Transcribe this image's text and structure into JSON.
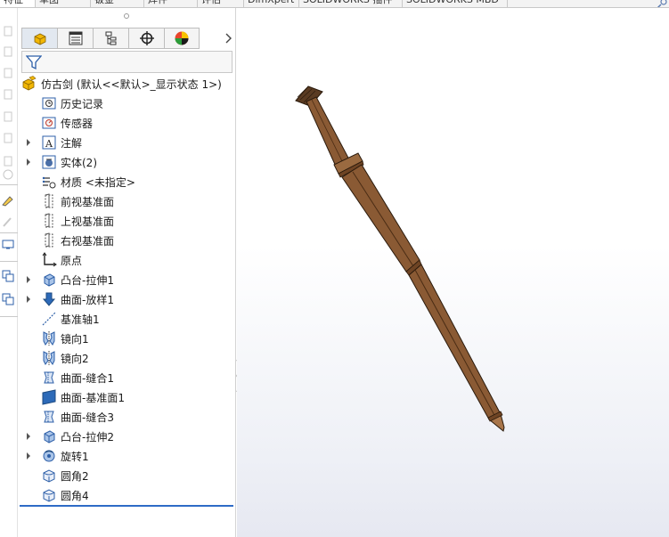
{
  "command_tabs": [
    "特征",
    "草图",
    "钣金",
    "焊件",
    "评估",
    "DimXpert",
    "SOLIDWORKS 插件",
    "SOLIDWORKS MBD"
  ],
  "manager_tabs": [
    {
      "name": "featuremanager-tab",
      "icon": "part-icon"
    },
    {
      "name": "propertymanager-tab",
      "icon": "property-list-icon"
    },
    {
      "name": "configurationmanager-tab",
      "icon": "configuration-icon"
    },
    {
      "name": "dimxpert-tab",
      "icon": "crosshair-icon"
    },
    {
      "name": "display-manager-tab",
      "icon": "appearance-sphere-icon"
    }
  ],
  "tree": {
    "root_label": "仿古剑  (默认<<默认>_显示状态 1>)",
    "items": [
      {
        "label": "历史记录",
        "icon": "history-icon",
        "expandable": false
      },
      {
        "label": "传感器",
        "icon": "sensor-icon",
        "expandable": false
      },
      {
        "label": "注解",
        "icon": "annotation-icon",
        "expandable": true
      },
      {
        "label": "实体(2)",
        "icon": "solid-bodies-icon",
        "expandable": true
      },
      {
        "label": "材质 <未指定>",
        "icon": "material-icon",
        "expandable": false
      },
      {
        "label": "前视基准面",
        "icon": "plane-icon",
        "expandable": false
      },
      {
        "label": "上视基准面",
        "icon": "plane-icon",
        "expandable": false
      },
      {
        "label": "右视基准面",
        "icon": "plane-icon",
        "expandable": false
      },
      {
        "label": "原点",
        "icon": "origin-icon",
        "expandable": false
      },
      {
        "label": "凸台-拉伸1",
        "icon": "boss-extrude-icon",
        "expandable": true
      },
      {
        "label": "曲面-放样1",
        "icon": "surface-loft-icon",
        "expandable": true
      },
      {
        "label": "基准轴1",
        "icon": "axis-icon",
        "expandable": false
      },
      {
        "label": "镜向1",
        "icon": "mirror-icon",
        "expandable": false
      },
      {
        "label": "镜向2",
        "icon": "mirror-icon",
        "expandable": false
      },
      {
        "label": "曲面-缝合1",
        "icon": "surface-knit-icon",
        "expandable": false
      },
      {
        "label": "曲面-基准面1",
        "icon": "planar-surface-icon",
        "expandable": false
      },
      {
        "label": "曲面-缝合3",
        "icon": "surface-knit-icon",
        "expandable": false
      },
      {
        "label": "凸台-拉伸2",
        "icon": "boss-extrude-icon",
        "expandable": true
      },
      {
        "label": "旋转1",
        "icon": "revolve-icon",
        "expandable": true
      },
      {
        "label": "圆角2",
        "icon": "fillet-icon",
        "expandable": false
      },
      {
        "label": "圆角4",
        "icon": "fillet-icon",
        "expandable": false
      }
    ]
  },
  "colors": {
    "accent_blue": "#2e6bc6",
    "sword_wood": "#8a5a34",
    "sword_dark": "#4a2c14",
    "sword_light": "#a8754a",
    "part_yellow": "#f2b705"
  }
}
